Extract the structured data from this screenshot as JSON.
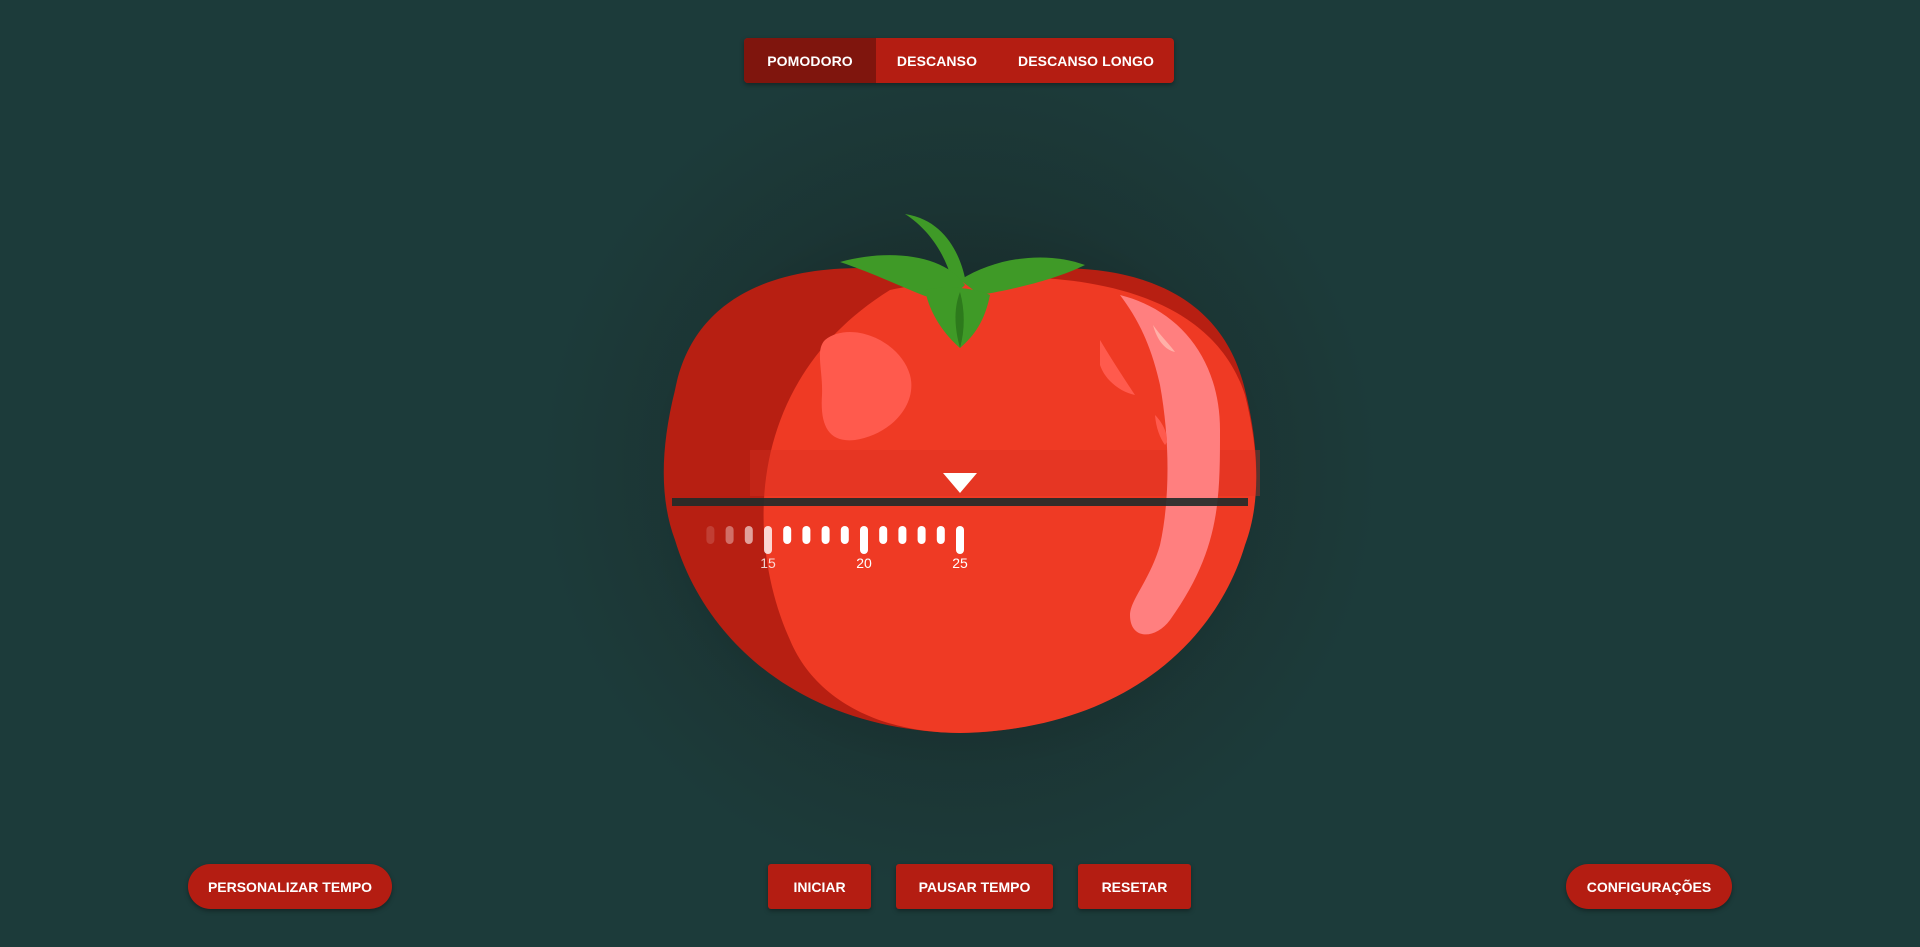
{
  "mode_tabs": [
    {
      "label": "POMODORO",
      "active": true
    },
    {
      "label": "DESCANSO",
      "active": false
    },
    {
      "label": "DESCANSO LONGO",
      "active": false
    }
  ],
  "timer": {
    "pointer_value": 25,
    "tick_labels": [
      "15",
      "20",
      "25"
    ]
  },
  "buttons": {
    "personalizar": "PERSONALIZAR TEMPO",
    "iniciar": "INICIAR",
    "pausar": "PAUSAR TEMPO",
    "resetar": "RESETAR",
    "configuracoes": "CONFIGURAÇÕES"
  },
  "colors": {
    "background": "#1c3b3a",
    "tomato_red": "#ef3a24",
    "tomato_dark": "#b71f12",
    "stem_green": "#3f9a27",
    "button_red": "#b41d12",
    "active_tab": "#7f150d"
  }
}
